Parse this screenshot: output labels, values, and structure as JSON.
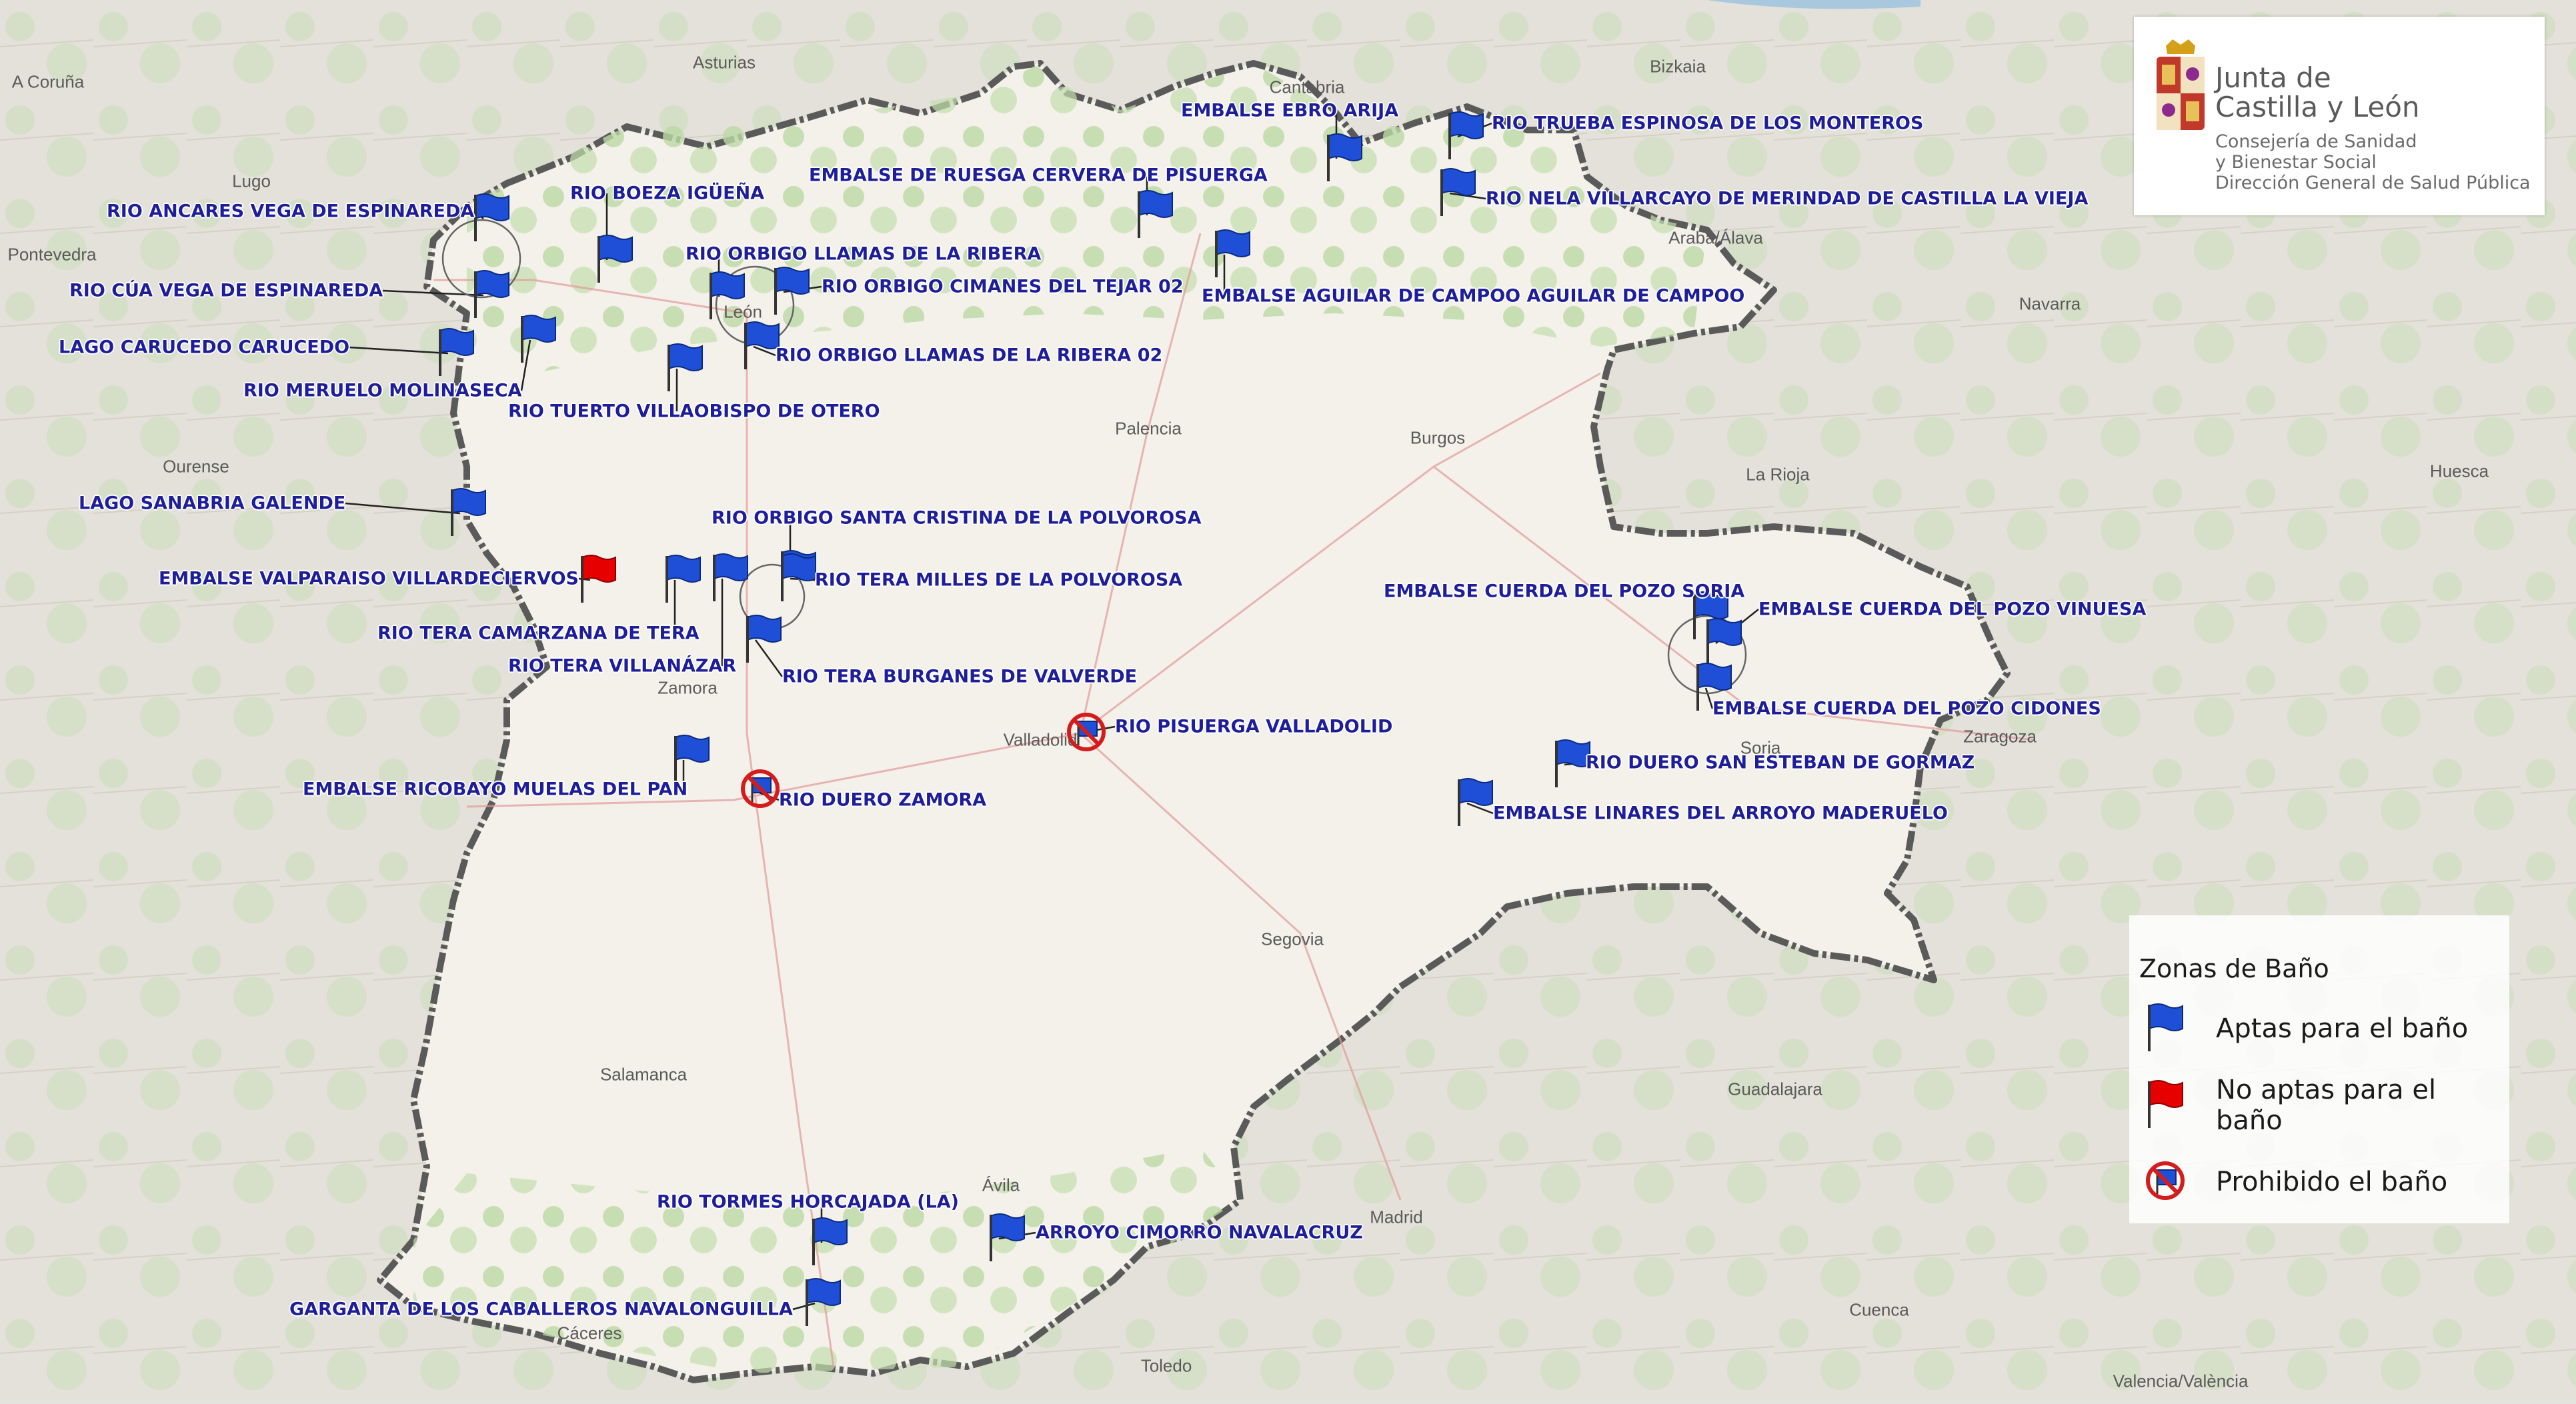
{
  "places": [
    {
      "name": "A Coruña"
    },
    {
      "name": "Asturias"
    },
    {
      "name": "Cantabria"
    },
    {
      "name": "Bizkaia"
    },
    {
      "name": "Lugo"
    },
    {
      "name": "Pontevedra"
    },
    {
      "name": "Araba/Álava"
    },
    {
      "name": "Navarra"
    },
    {
      "name": "León"
    },
    {
      "name": "Ourense"
    },
    {
      "name": "Palencia"
    },
    {
      "name": "Burgos"
    },
    {
      "name": "La Rioja"
    },
    {
      "name": "Huesca"
    },
    {
      "name": "Zamora"
    },
    {
      "name": "Soria"
    },
    {
      "name": "Zaragoza"
    },
    {
      "name": "Valladolid"
    },
    {
      "name": "Segovia"
    },
    {
      "name": "Salamanca"
    },
    {
      "name": "Guadalajara"
    },
    {
      "name": "Ávila"
    },
    {
      "name": "Madrid"
    },
    {
      "name": "Cuenca"
    },
    {
      "name": "Cáceres"
    },
    {
      "name": "Toledo"
    },
    {
      "name": "Valencia/València"
    }
  ],
  "zones": [
    {
      "label": "RIO ANCARES VEGA DE ESPINAREDA",
      "status": "apta"
    },
    {
      "label": "RIO CÚA VEGA DE ESPINAREDA",
      "status": "apta"
    },
    {
      "label": "LAGO CARUCEDO CARUCEDO",
      "status": "apta"
    },
    {
      "label": "RIO MERUELO MOLINASECA",
      "status": "apta"
    },
    {
      "label": "RIO BOEZA IGÜEÑA",
      "status": "apta"
    },
    {
      "label": "RIO ORBIGO LLAMAS DE LA RIBERA",
      "status": "apta"
    },
    {
      "label": "RIO ORBIGO CIMANES DEL TEJAR 02",
      "status": "apta"
    },
    {
      "label": "RIO ORBIGO LLAMAS DE LA RIBERA 02",
      "status": "apta"
    },
    {
      "label": "RIO TUERTO VILLAOBISPO DE OTERO",
      "status": "apta"
    },
    {
      "label": "EMBALSE DE RUESGA CERVERA DE PISUERGA",
      "status": "apta"
    },
    {
      "label": "EMBALSE EBRO ARIJA",
      "status": "apta"
    },
    {
      "label": "RIO TRUEBA ESPINOSA DE LOS MONTEROS",
      "status": "apta"
    },
    {
      "label": "RIO NELA VILLARCAYO DE MERINDAD DE CASTILLA LA VIEJA",
      "status": "apta"
    },
    {
      "label": "EMBALSE AGUILAR DE CAMPOO AGUILAR DE CAMPOO",
      "status": "apta"
    },
    {
      "label": "LAGO SANABRIA GALENDE",
      "status": "apta"
    },
    {
      "label": "RIO ORBIGO SANTA CRISTINA DE LA POLVOROSA",
      "status": "apta"
    },
    {
      "label": "EMBALSE VALPARAISO VILLARDECIERVOS",
      "status": "no_apta"
    },
    {
      "label": "RIO TERA MILLES DE LA POLVOROSA",
      "status": "apta"
    },
    {
      "label": "RIO TERA CAMARZANA DE TERA",
      "status": "apta"
    },
    {
      "label": "RIO TERA VILLANÁZAR",
      "status": "apta"
    },
    {
      "label": "RIO TERA BURGANES DE VALVERDE",
      "status": "apta"
    },
    {
      "label": "EMBALSE CUERDA DEL POZO SORIA",
      "status": "apta"
    },
    {
      "label": "EMBALSE CUERDA DEL POZO VINUESA",
      "status": "apta"
    },
    {
      "label": "EMBALSE CUERDA DEL POZO CIDONES",
      "status": "apta"
    },
    {
      "label": "RIO PISUERGA VALLADOLID",
      "status": "prohibido"
    },
    {
      "label": "EMBALSE RICOBAYO MUELAS DEL PAN",
      "status": "apta"
    },
    {
      "label": "RIO DUERO ZAMORA",
      "status": "prohibido"
    },
    {
      "label": "RIO DUERO SAN ESTEBAN DE GORMAZ",
      "status": "apta"
    },
    {
      "label": "EMBALSE LINARES DEL ARROYO MADERUELO",
      "status": "apta"
    },
    {
      "label": "RIO TORMES HORCAJADA (LA)",
      "status": "apta"
    },
    {
      "label": "ARROYO CIMORRO NAVALACRUZ",
      "status": "apta"
    },
    {
      "label": "GARGANTA DE LOS CABALLEROS NAVALONGUILLA",
      "status": "apta"
    }
  ],
  "logo": {
    "title_line1": "Junta de",
    "title_line2": "Castilla y León",
    "sub_line1": "Consejería de Sanidad",
    "sub_line2": "y Bienestar Social",
    "sub_line3": "Dirección General de Salud Pública"
  },
  "legend": {
    "title": "Zonas de Baño",
    "items": [
      {
        "label": "Aptas para el baño",
        "status": "apta"
      },
      {
        "label": "No aptas para el baño",
        "status": "no_apta"
      },
      {
        "label": "Prohibido el baño",
        "status": "prohibido"
      }
    ]
  },
  "colors": {
    "apta_flag": "#1f4fd6",
    "no_apta_flag": "#e60000",
    "prohibited_ring": "#d41c1c",
    "label_text": "#1e1e9a",
    "region_fill": "#f3f1ea",
    "region_border": "#5a5a5a"
  }
}
